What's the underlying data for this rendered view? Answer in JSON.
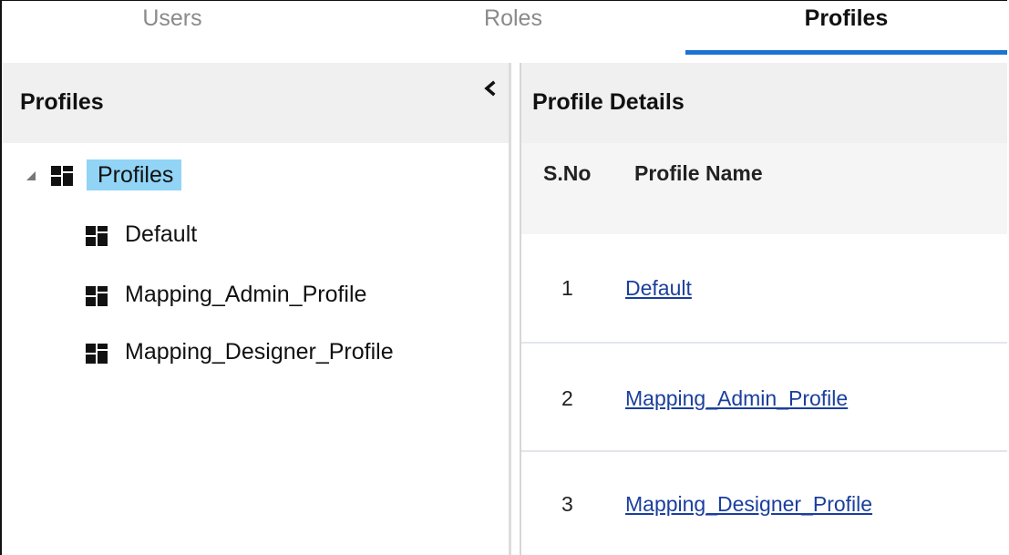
{
  "tabs": [
    {
      "label": "Users",
      "active": false
    },
    {
      "label": "Roles",
      "active": false
    },
    {
      "label": "Profiles",
      "active": true
    }
  ],
  "colors": {
    "accent": "#1c73d4",
    "selection": "#91d4f5",
    "link": "#1a3f9c",
    "header_bg": "#f0f0f0"
  },
  "left_panel": {
    "title": "Profiles",
    "collapse_icon": "chevron-left-icon",
    "tree": {
      "root": {
        "label": "Profiles",
        "icon": "profile-grid-icon",
        "expanded": true,
        "selected": true
      },
      "children": [
        {
          "label": "Default",
          "icon": "profile-grid-icon"
        },
        {
          "label": "Mapping_Admin_Profile",
          "icon": "profile-grid-icon"
        },
        {
          "label": "Mapping_Designer_Profile",
          "icon": "profile-grid-icon"
        }
      ]
    }
  },
  "right_panel": {
    "title": "Profile Details",
    "columns": [
      "S.No",
      "Profile Name"
    ],
    "rows": [
      {
        "sno": "1",
        "name": "Default"
      },
      {
        "sno": "2",
        "name": "Mapping_Admin_Profile"
      },
      {
        "sno": "3",
        "name": "Mapping_Designer_Profile"
      }
    ]
  }
}
